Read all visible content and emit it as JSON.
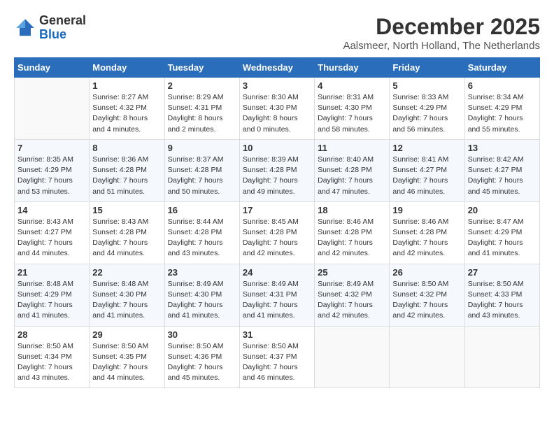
{
  "header": {
    "logo_general": "General",
    "logo_blue": "Blue",
    "month": "December 2025",
    "location": "Aalsmeer, North Holland, The Netherlands"
  },
  "days_of_week": [
    "Sunday",
    "Monday",
    "Tuesday",
    "Wednesday",
    "Thursday",
    "Friday",
    "Saturday"
  ],
  "weeks": [
    [
      {
        "day": "",
        "sunrise": "",
        "sunset": "",
        "daylight": ""
      },
      {
        "day": "1",
        "sunrise": "Sunrise: 8:27 AM",
        "sunset": "Sunset: 4:32 PM",
        "daylight": "Daylight: 8 hours and 4 minutes."
      },
      {
        "day": "2",
        "sunrise": "Sunrise: 8:29 AM",
        "sunset": "Sunset: 4:31 PM",
        "daylight": "Daylight: 8 hours and 2 minutes."
      },
      {
        "day": "3",
        "sunrise": "Sunrise: 8:30 AM",
        "sunset": "Sunset: 4:30 PM",
        "daylight": "Daylight: 8 hours and 0 minutes."
      },
      {
        "day": "4",
        "sunrise": "Sunrise: 8:31 AM",
        "sunset": "Sunset: 4:30 PM",
        "daylight": "Daylight: 7 hours and 58 minutes."
      },
      {
        "day": "5",
        "sunrise": "Sunrise: 8:33 AM",
        "sunset": "Sunset: 4:29 PM",
        "daylight": "Daylight: 7 hours and 56 minutes."
      },
      {
        "day": "6",
        "sunrise": "Sunrise: 8:34 AM",
        "sunset": "Sunset: 4:29 PM",
        "daylight": "Daylight: 7 hours and 55 minutes."
      }
    ],
    [
      {
        "day": "7",
        "sunrise": "Sunrise: 8:35 AM",
        "sunset": "Sunset: 4:29 PM",
        "daylight": "Daylight: 7 hours and 53 minutes."
      },
      {
        "day": "8",
        "sunrise": "Sunrise: 8:36 AM",
        "sunset": "Sunset: 4:28 PM",
        "daylight": "Daylight: 7 hours and 51 minutes."
      },
      {
        "day": "9",
        "sunrise": "Sunrise: 8:37 AM",
        "sunset": "Sunset: 4:28 PM",
        "daylight": "Daylight: 7 hours and 50 minutes."
      },
      {
        "day": "10",
        "sunrise": "Sunrise: 8:39 AM",
        "sunset": "Sunset: 4:28 PM",
        "daylight": "Daylight: 7 hours and 49 minutes."
      },
      {
        "day": "11",
        "sunrise": "Sunrise: 8:40 AM",
        "sunset": "Sunset: 4:28 PM",
        "daylight": "Daylight: 7 hours and 47 minutes."
      },
      {
        "day": "12",
        "sunrise": "Sunrise: 8:41 AM",
        "sunset": "Sunset: 4:27 PM",
        "daylight": "Daylight: 7 hours and 46 minutes."
      },
      {
        "day": "13",
        "sunrise": "Sunrise: 8:42 AM",
        "sunset": "Sunset: 4:27 PM",
        "daylight": "Daylight: 7 hours and 45 minutes."
      }
    ],
    [
      {
        "day": "14",
        "sunrise": "Sunrise: 8:43 AM",
        "sunset": "Sunset: 4:27 PM",
        "daylight": "Daylight: 7 hours and 44 minutes."
      },
      {
        "day": "15",
        "sunrise": "Sunrise: 8:43 AM",
        "sunset": "Sunset: 4:28 PM",
        "daylight": "Daylight: 7 hours and 44 minutes."
      },
      {
        "day": "16",
        "sunrise": "Sunrise: 8:44 AM",
        "sunset": "Sunset: 4:28 PM",
        "daylight": "Daylight: 7 hours and 43 minutes."
      },
      {
        "day": "17",
        "sunrise": "Sunrise: 8:45 AM",
        "sunset": "Sunset: 4:28 PM",
        "daylight": "Daylight: 7 hours and 42 minutes."
      },
      {
        "day": "18",
        "sunrise": "Sunrise: 8:46 AM",
        "sunset": "Sunset: 4:28 PM",
        "daylight": "Daylight: 7 hours and 42 minutes."
      },
      {
        "day": "19",
        "sunrise": "Sunrise: 8:46 AM",
        "sunset": "Sunset: 4:28 PM",
        "daylight": "Daylight: 7 hours and 42 minutes."
      },
      {
        "day": "20",
        "sunrise": "Sunrise: 8:47 AM",
        "sunset": "Sunset: 4:29 PM",
        "daylight": "Daylight: 7 hours and 41 minutes."
      }
    ],
    [
      {
        "day": "21",
        "sunrise": "Sunrise: 8:48 AM",
        "sunset": "Sunset: 4:29 PM",
        "daylight": "Daylight: 7 hours and 41 minutes."
      },
      {
        "day": "22",
        "sunrise": "Sunrise: 8:48 AM",
        "sunset": "Sunset: 4:30 PM",
        "daylight": "Daylight: 7 hours and 41 minutes."
      },
      {
        "day": "23",
        "sunrise": "Sunrise: 8:49 AM",
        "sunset": "Sunset: 4:30 PM",
        "daylight": "Daylight: 7 hours and 41 minutes."
      },
      {
        "day": "24",
        "sunrise": "Sunrise: 8:49 AM",
        "sunset": "Sunset: 4:31 PM",
        "daylight": "Daylight: 7 hours and 41 minutes."
      },
      {
        "day": "25",
        "sunrise": "Sunrise: 8:49 AM",
        "sunset": "Sunset: 4:32 PM",
        "daylight": "Daylight: 7 hours and 42 minutes."
      },
      {
        "day": "26",
        "sunrise": "Sunrise: 8:50 AM",
        "sunset": "Sunset: 4:32 PM",
        "daylight": "Daylight: 7 hours and 42 minutes."
      },
      {
        "day": "27",
        "sunrise": "Sunrise: 8:50 AM",
        "sunset": "Sunset: 4:33 PM",
        "daylight": "Daylight: 7 hours and 43 minutes."
      }
    ],
    [
      {
        "day": "28",
        "sunrise": "Sunrise: 8:50 AM",
        "sunset": "Sunset: 4:34 PM",
        "daylight": "Daylight: 7 hours and 43 minutes."
      },
      {
        "day": "29",
        "sunrise": "Sunrise: 8:50 AM",
        "sunset": "Sunset: 4:35 PM",
        "daylight": "Daylight: 7 hours and 44 minutes."
      },
      {
        "day": "30",
        "sunrise": "Sunrise: 8:50 AM",
        "sunset": "Sunset: 4:36 PM",
        "daylight": "Daylight: 7 hours and 45 minutes."
      },
      {
        "day": "31",
        "sunrise": "Sunrise: 8:50 AM",
        "sunset": "Sunset: 4:37 PM",
        "daylight": "Daylight: 7 hours and 46 minutes."
      },
      {
        "day": "",
        "sunrise": "",
        "sunset": "",
        "daylight": ""
      },
      {
        "day": "",
        "sunrise": "",
        "sunset": "",
        "daylight": ""
      },
      {
        "day": "",
        "sunrise": "",
        "sunset": "",
        "daylight": ""
      }
    ]
  ]
}
